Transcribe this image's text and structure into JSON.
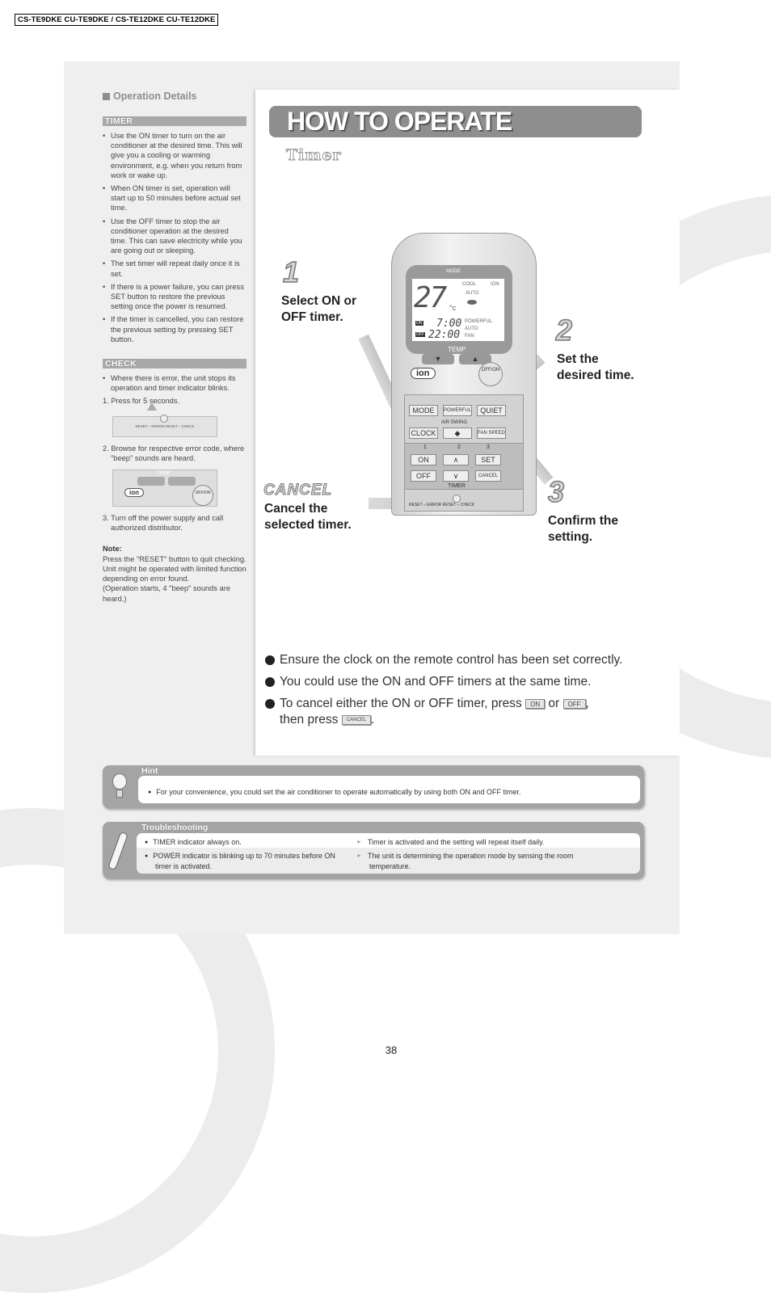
{
  "header": {
    "model_label": "CS-TE9DKE CU-TE9DKE / CS-TE12DKE CU-TE12DKE"
  },
  "left": {
    "section_title": "Operation Details",
    "timer": {
      "title": "TIMER",
      "bullets": [
        "Use the ON timer to turn on the air conditioner at the desired time. This will give you a cooling or warming environment, e.g. when you return from work or wake up.",
        "When ON timer is set, operation will start up to 50 minutes before actual set time.",
        "Use the OFF timer to stop the air conditioner operation at the desired time. This can save electricity while you are going out or sleeping.",
        "The set timer will repeat daily once it is set.",
        "If there is a power failure, you can press SET button to restore the previous setting once the power is resumed.",
        "If the timer is cancelled, you can restore the previous setting by pressing SET button."
      ]
    },
    "check": {
      "title": "CHECK",
      "bullet": "Where there is error, the unit stops its operation and timer indicator blinks.",
      "step1": "1. Press for 5 seconds.",
      "step1_image_labels": "RESET – ERROR RESET – CHECK",
      "step2": "2. Browse for respective error code, where \"beep\" sounds are heard.",
      "step2_image_labels": {
        "temp": "TEMP",
        "ion": "ion",
        "offon": "OFF/ON"
      },
      "step3": "3. Turn off the power supply and call authorized distributor.",
      "note_title": "Note:",
      "note_lines": [
        "Press the \"RESET\" button to quit checking.",
        "Unit might be operated with limited function depending on error found.",
        "(Operation starts, 4 \"beep\" sounds are heard.)"
      ]
    }
  },
  "main": {
    "banner": "HOW TO OPERATE",
    "subtitle": "Timer",
    "steps": [
      {
        "number": "1",
        "text1": "Select ON or",
        "text2": "OFF timer."
      },
      {
        "number": "2",
        "text1": "Set the",
        "text2": "desired time."
      },
      {
        "number": "3",
        "text1": "Confirm the",
        "text2": "setting."
      }
    ],
    "cancel": {
      "label": "CANCEL",
      "text1": "Cancel the",
      "text2": "selected timer."
    },
    "remote": {
      "mode": "MODE",
      "display": {
        "temp": "27",
        "unit": "°c",
        "cool": "COOL",
        "ion": "ION",
        "auto": "AUTO",
        "on_tag": "ON",
        "on_time": "7:00",
        "off_tag": "OFF",
        "off_time": "22:00",
        "powerful": "POWERFUL",
        "auto2": "AUTO",
        "fan": "FAN"
      },
      "temp_label": "TEMP",
      "ion_button": "ion",
      "offon_button": "OFF/ON",
      "buttons": {
        "mode": "MODE",
        "powerful": "POWERFUL",
        "quiet": "QUIET",
        "air_swing": "AIR SWING",
        "clock": "CLOCK",
        "fan_speed": "FAN SPEED",
        "on": "ON",
        "off": "OFF",
        "set": "SET",
        "cancel": "CANCEL",
        "up": "∧",
        "down": "∨"
      },
      "seq": [
        "1",
        "2",
        "3"
      ],
      "timer_label": "TIMER",
      "bottom": "RESET – ERROR RESET – CHECK"
    },
    "notes": [
      {
        "text": "Ensure the clock on the remote control has been set correctly."
      },
      {
        "text": "You could use the ON and OFF timers at the same time."
      },
      {
        "pre": "To cancel either the ON or OFF timer, press",
        "k1": "ON",
        "mid": "or",
        "k2": "OFF",
        "post": ",",
        "line2": "then press",
        "k3": "CANCEL",
        "end": "."
      }
    ]
  },
  "hint": {
    "title": "Hint",
    "text": "For your convenience, you could set the air conditioner to operate automatically by using both ON and OFF timer."
  },
  "troubleshooting": {
    "title": "Troubleshooting",
    "rows": [
      {
        "symptom": "TIMER indicator always on.",
        "cause": "Timer is activated and the setting will repeat itself daily."
      },
      {
        "symptom": "POWER indicator is blinking up to 70 minutes before ON timer is activated.",
        "cause": "The unit is determining the operation mode by sensing the room temperature."
      }
    ]
  },
  "footer": {
    "page_number": "38"
  }
}
